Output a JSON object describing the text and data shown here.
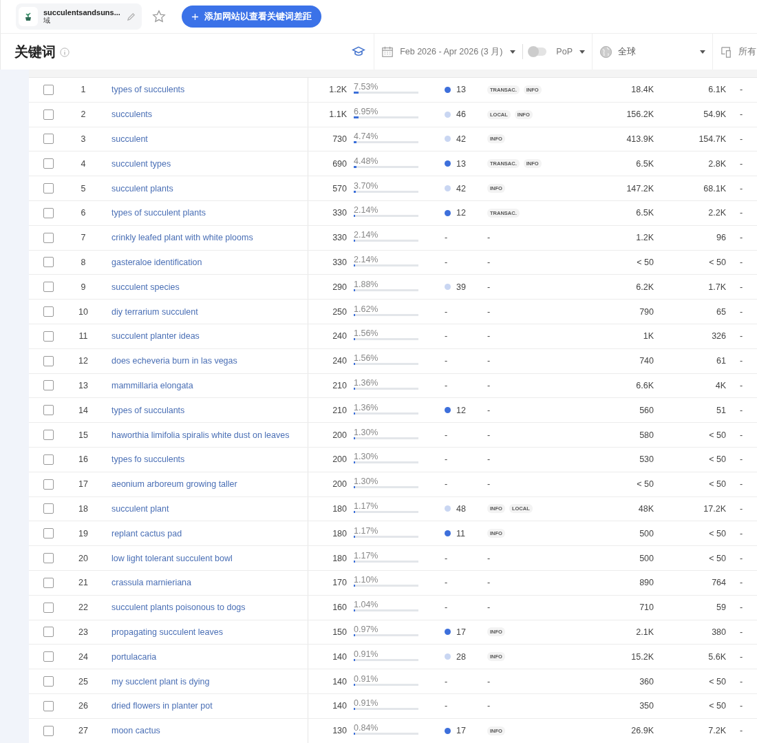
{
  "site": {
    "name": "succulentsandsuns...",
    "type": "域"
  },
  "starred": false,
  "add_button": "添加网站以查看关键词差距",
  "toolbar": {
    "title": "关键词",
    "date_range": "Feb 2026 - Apr 2026 (3 月)",
    "pop": {
      "label": "PoP",
      "on": false
    },
    "location": "全球",
    "device": "所有"
  },
  "rows": [
    {
      "n": "1",
      "keyword": "types of succulents",
      "volume": "1.2K",
      "share": "7.53%",
      "level": 0.0753,
      "kd": "13",
      "color": "#3d6fdb",
      "intents": [
        {
          "label": "TRANSAC.",
          "kind": "tag"
        },
        {
          "label": "INFO",
          "kind": "tag"
        }
      ],
      "column_7": "18.4K",
      "column_8": "6.1K",
      "column_9": "-",
      "checked": false
    },
    {
      "n": "2",
      "keyword": "succulents",
      "volume": "1.1K",
      "share": "6.95%",
      "level": 0.0695,
      "kd": "46",
      "color": "#c9d6f2",
      "intents": [
        {
          "label": "LOCAL",
          "kind": "tag"
        },
        {
          "label": "INFO",
          "kind": "tag"
        }
      ],
      "column_7": "156.2K",
      "column_8": "54.9K",
      "column_9": "-",
      "checked": false
    },
    {
      "n": "3",
      "keyword": "succulent",
      "volume": "730",
      "share": "4.74%",
      "level": 0.0474,
      "kd": "42",
      "color": "#c9d6f2",
      "intents": [
        {
          "label": "INFO",
          "kind": "tag"
        }
      ],
      "column_7": "413.9K",
      "column_8": "154.7K",
      "column_9": "-",
      "checked": false
    },
    {
      "n": "4",
      "keyword": "succulent types",
      "volume": "690",
      "share": "4.48%",
      "level": 0.0448,
      "kd": "13",
      "color": "#3d6fdb",
      "intents": [
        {
          "label": "TRANSAC.",
          "kind": "tag"
        },
        {
          "label": "INFO",
          "kind": "tag"
        }
      ],
      "column_7": "6.5K",
      "column_8": "2.8K",
      "column_9": "-",
      "checked": false
    },
    {
      "n": "5",
      "keyword": "succulent plants",
      "volume": "570",
      "share": "3.70%",
      "level": 0.037,
      "kd": "42",
      "color": "#c9d6f2",
      "intents": [
        {
          "label": "INFO",
          "kind": "tag"
        }
      ],
      "column_7": "147.2K",
      "column_8": "68.1K",
      "column_9": "-",
      "checked": false
    },
    {
      "n": "6",
      "keyword": "types of succulent plants",
      "volume": "330",
      "share": "2.14%",
      "level": 0.0214,
      "kd": "12",
      "color": "#3d6fdb",
      "intents": [
        {
          "label": "TRANSAC.",
          "kind": "tag"
        }
      ],
      "column_7": "6.5K",
      "column_8": "2.2K",
      "column_9": "-",
      "checked": false
    },
    {
      "n": "7",
      "keyword": "crinkly leafed plant with white plooms",
      "volume": "330",
      "share": "2.14%",
      "level": 0.0214,
      "kd": "-",
      "intents": [
        {
          "label": "-",
          "kind": "none"
        }
      ],
      "column_7": "1.2K",
      "column_8": "96",
      "column_9": "-",
      "checked": false
    },
    {
      "n": "8",
      "keyword": "gasteraloe identification",
      "volume": "330",
      "share": "2.14%",
      "level": 0.0214,
      "kd": "-",
      "intents": [
        {
          "label": "-",
          "kind": "none"
        }
      ],
      "column_7": "< 50",
      "column_8": "< 50",
      "column_9": "-",
      "checked": false
    },
    {
      "n": "9",
      "keyword": "succulent species",
      "volume": "290",
      "share": "1.88%",
      "level": 0.0188,
      "kd": "39",
      "color": "#c9d6f2",
      "intents": [
        {
          "label": "-",
          "kind": "none"
        }
      ],
      "column_7": "6.2K",
      "column_8": "1.7K",
      "column_9": "-",
      "checked": false
    },
    {
      "n": "10",
      "keyword": "diy terrarium succulent",
      "volume": "250",
      "share": "1.62%",
      "level": 0.0162,
      "kd": "-",
      "intents": [
        {
          "label": "-",
          "kind": "none"
        }
      ],
      "column_7": "790",
      "column_8": "65",
      "column_9": "-",
      "checked": false
    },
    {
      "n": "11",
      "keyword": "succulent planter ideas",
      "volume": "240",
      "share": "1.56%",
      "level": 0.0156,
      "kd": "-",
      "intents": [
        {
          "label": "-",
          "kind": "none"
        }
      ],
      "column_7": "1K",
      "column_8": "326",
      "column_9": "-",
      "checked": false
    },
    {
      "n": "12",
      "keyword": "does echeveria burn in las vegas",
      "volume": "240",
      "share": "1.56%",
      "level": 0.0156,
      "kd": "-",
      "intents": [
        {
          "label": "-",
          "kind": "none"
        }
      ],
      "column_7": "740",
      "column_8": "61",
      "column_9": "-",
      "checked": false
    },
    {
      "n": "13",
      "keyword": "mammillaria elongata",
      "volume": "210",
      "share": "1.36%",
      "level": 0.0136,
      "kd": "-",
      "intents": [
        {
          "label": "-",
          "kind": "none"
        }
      ],
      "column_7": "6.6K",
      "column_8": "4K",
      "column_9": "-",
      "checked": false
    },
    {
      "n": "14",
      "keyword": "types of succulants",
      "volume": "210",
      "share": "1.36%",
      "level": 0.0136,
      "kd": "12",
      "color": "#3d6fdb",
      "intents": [
        {
          "label": "-",
          "kind": "none"
        }
      ],
      "column_7": "560",
      "column_8": "51",
      "column_9": "-",
      "checked": false
    },
    {
      "n": "15",
      "keyword": "haworthia limifolia spiralis white dust on leaves",
      "volume": "200",
      "share": "1.30%",
      "level": 0.013,
      "kd": "-",
      "intents": [
        {
          "label": "-",
          "kind": "none"
        }
      ],
      "column_7": "580",
      "column_8": "< 50",
      "column_9": "-",
      "checked": false
    },
    {
      "n": "16",
      "keyword": "types fo succulents",
      "volume": "200",
      "share": "1.30%",
      "level": 0.013,
      "kd": "-",
      "intents": [
        {
          "label": "-",
          "kind": "none"
        }
      ],
      "column_7": "530",
      "column_8": "< 50",
      "column_9": "-",
      "checked": false
    },
    {
      "n": "17",
      "keyword": "aeonium arboreum growing taller",
      "volume": "200",
      "share": "1.30%",
      "level": 0.013,
      "kd": "-",
      "intents": [
        {
          "label": "-",
          "kind": "none"
        }
      ],
      "column_7": "< 50",
      "column_8": "< 50",
      "column_9": "-",
      "checked": false
    },
    {
      "n": "18",
      "keyword": "succulent plant",
      "volume": "180",
      "share": "1.17%",
      "level": 0.0117,
      "kd": "48",
      "color": "#c9d6f2",
      "intents": [
        {
          "label": "INFO",
          "kind": "tag"
        },
        {
          "label": "LOCAL",
          "kind": "tag"
        }
      ],
      "column_7": "48K",
      "column_8": "17.2K",
      "column_9": "-",
      "checked": false
    },
    {
      "n": "19",
      "keyword": "replant cactus pad",
      "volume": "180",
      "share": "1.17%",
      "level": 0.0117,
      "kd": "11",
      "color": "#3d6fdb",
      "intents": [
        {
          "label": "INFO",
          "kind": "tag"
        }
      ],
      "column_7": "500",
      "column_8": "< 50",
      "column_9": "-",
      "checked": false
    },
    {
      "n": "20",
      "keyword": "low light tolerant succulent bowl",
      "volume": "180",
      "share": "1.17%",
      "level": 0.0117,
      "kd": "-",
      "intents": [
        {
          "label": "-",
          "kind": "none"
        }
      ],
      "column_7": "500",
      "column_8": "< 50",
      "column_9": "-",
      "checked": false
    },
    {
      "n": "21",
      "keyword": "crassula marnieriana",
      "volume": "170",
      "share": "1.10%",
      "level": 0.011,
      "kd": "-",
      "intents": [
        {
          "label": "-",
          "kind": "none"
        }
      ],
      "column_7": "890",
      "column_8": "764",
      "column_9": "-",
      "checked": false
    },
    {
      "n": "22",
      "keyword": "succulent plants poisonous to dogs",
      "volume": "160",
      "share": "1.04%",
      "level": 0.0104,
      "kd": "-",
      "intents": [
        {
          "label": "-",
          "kind": "none"
        }
      ],
      "column_7": "710",
      "column_8": "59",
      "column_9": "-",
      "checked": false
    },
    {
      "n": "23",
      "keyword": "propagating succulent leaves",
      "volume": "150",
      "share": "0.97%",
      "level": 0.0097,
      "kd": "17",
      "color": "#3d6fdb",
      "intents": [
        {
          "label": "INFO",
          "kind": "tag"
        }
      ],
      "column_7": "2.1K",
      "column_8": "380",
      "column_9": "-",
      "checked": false
    },
    {
      "n": "24",
      "keyword": "portulacaria",
      "volume": "140",
      "share": "0.91%",
      "level": 0.0091,
      "kd": "28",
      "color": "#c9d6f2",
      "intents": [
        {
          "label": "INFO",
          "kind": "tag"
        }
      ],
      "column_7": "15.2K",
      "column_8": "5.6K",
      "column_9": "-",
      "checked": false
    },
    {
      "n": "25",
      "keyword": "my succlent plant is dying",
      "volume": "140",
      "share": "0.91%",
      "level": 0.0091,
      "kd": "-",
      "intents": [
        {
          "label": "-",
          "kind": "none"
        }
      ],
      "column_7": "360",
      "column_8": "< 50",
      "column_9": "-",
      "checked": false
    },
    {
      "n": "26",
      "keyword": "dried flowers in planter pot",
      "volume": "140",
      "share": "0.91%",
      "level": 0.0091,
      "kd": "-",
      "intents": [
        {
          "label": "-",
          "kind": "none"
        }
      ],
      "column_7": "350",
      "column_8": "< 50",
      "column_9": "-",
      "checked": false
    },
    {
      "n": "27",
      "keyword": "moon cactus",
      "volume": "130",
      "share": "0.84%",
      "level": 0.0084,
      "kd": "17",
      "color": "#3d6fdb",
      "intents": [
        {
          "label": "INFO",
          "kind": "tag"
        }
      ],
      "column_7": "26.9K",
      "column_8": "7.2K",
      "column_9": "-",
      "checked": false
    }
  ]
}
